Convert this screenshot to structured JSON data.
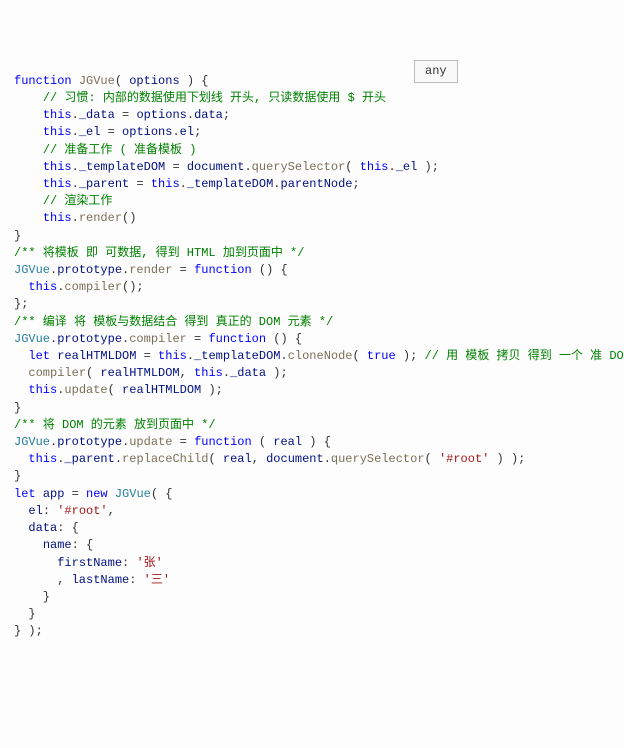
{
  "tooltip": "any",
  "lines": [
    [
      [
        "kw",
        "function "
      ],
      [
        "fn",
        "JGVue"
      ],
      [
        "punc",
        "( "
      ],
      [
        "prop",
        "options"
      ],
      [
        "punc",
        " ) {"
      ]
    ],
    [
      [
        "punc",
        "    "
      ],
      [
        "cmt",
        "// 习惯: 内部的数据使用下划线 开头, 只读数据使用 $ 开头"
      ]
    ],
    [
      [
        "punc",
        "    "
      ],
      [
        "kw",
        "this"
      ],
      [
        "punc",
        "."
      ],
      [
        "prop",
        "_data"
      ],
      [
        "punc",
        " = "
      ],
      [
        "prop",
        "options"
      ],
      [
        "punc",
        "."
      ],
      [
        "prop",
        "data"
      ],
      [
        "punc",
        ";"
      ]
    ],
    [
      [
        "punc",
        "    "
      ],
      [
        "kw",
        "this"
      ],
      [
        "punc",
        "."
      ],
      [
        "prop",
        "_el"
      ],
      [
        "punc",
        " = "
      ],
      [
        "prop",
        "options"
      ],
      [
        "punc",
        "."
      ],
      [
        "prop",
        "el"
      ],
      [
        "punc",
        ";"
      ]
    ],
    [
      [
        "punc",
        "    "
      ],
      [
        "cmt",
        "// 准备工作 ( 准备模板 )"
      ]
    ],
    [
      [
        "punc",
        "    "
      ],
      [
        "kw",
        "this"
      ],
      [
        "punc",
        "."
      ],
      [
        "prop",
        "_templateDOM"
      ],
      [
        "punc",
        " = "
      ],
      [
        "prop",
        "document"
      ],
      [
        "punc",
        "."
      ],
      [
        "fn",
        "querySelector"
      ],
      [
        "punc",
        "( "
      ],
      [
        "kw",
        "this"
      ],
      [
        "punc",
        "."
      ],
      [
        "prop",
        "_el"
      ],
      [
        "punc",
        " );"
      ]
    ],
    [
      [
        "punc",
        "    "
      ],
      [
        "kw",
        "this"
      ],
      [
        "punc",
        "."
      ],
      [
        "prop",
        "_parent"
      ],
      [
        "punc",
        " = "
      ],
      [
        "kw",
        "this"
      ],
      [
        "punc",
        "."
      ],
      [
        "prop",
        "_templateDOM"
      ],
      [
        "punc",
        "."
      ],
      [
        "prop",
        "parentNode"
      ],
      [
        "punc",
        ";"
      ]
    ],
    [
      [
        "punc",
        "    "
      ],
      [
        "cmt",
        "// 渲染工作"
      ]
    ],
    [
      [
        "punc",
        "    "
      ],
      [
        "kw",
        "this"
      ],
      [
        "punc",
        "."
      ],
      [
        "fn",
        "render"
      ],
      [
        "punc",
        "()"
      ]
    ],
    [
      [
        "punc",
        "}"
      ]
    ],
    [
      [
        "cmt",
        "/** 将模板 即 可数据, 得到 HTML 加到页面中 */"
      ]
    ],
    [
      [
        "var",
        "JGVue"
      ],
      [
        "punc",
        "."
      ],
      [
        "prop",
        "prototype"
      ],
      [
        "punc",
        "."
      ],
      [
        "fn",
        "render"
      ],
      [
        "punc",
        " = "
      ],
      [
        "kw",
        "function"
      ],
      [
        "punc",
        " () {"
      ]
    ],
    [
      [
        "punc",
        "  "
      ],
      [
        "kw",
        "this"
      ],
      [
        "punc",
        "."
      ],
      [
        "fn",
        "compiler"
      ],
      [
        "punc",
        "();"
      ]
    ],
    [
      [
        "punc",
        "};"
      ]
    ],
    [
      [
        "cmt",
        "/** 编译 将 模板与数据结合 得到 真正的 DOM 元素 */"
      ]
    ],
    [
      [
        "var",
        "JGVue"
      ],
      [
        "punc",
        "."
      ],
      [
        "prop",
        "prototype"
      ],
      [
        "punc",
        "."
      ],
      [
        "fn",
        "compiler"
      ],
      [
        "punc",
        " = "
      ],
      [
        "kw",
        "function"
      ],
      [
        "punc",
        " () {"
      ]
    ],
    [
      [
        "punc",
        "  "
      ],
      [
        "kw",
        "let"
      ],
      [
        "punc",
        " "
      ],
      [
        "prop",
        "realHTMLDOM"
      ],
      [
        "punc",
        " = "
      ],
      [
        "kw",
        "this"
      ],
      [
        "punc",
        "."
      ],
      [
        "prop",
        "_templateDOM"
      ],
      [
        "punc",
        "."
      ],
      [
        "fn",
        "cloneNode"
      ],
      [
        "punc",
        "( "
      ],
      [
        "kw",
        "true"
      ],
      [
        "punc",
        " ); "
      ],
      [
        "cmt",
        "// 用 模板 拷贝 得到 一个 准 DOM"
      ]
    ],
    [
      [
        "punc",
        "  "
      ],
      [
        "fn",
        "compiler"
      ],
      [
        "punc",
        "( "
      ],
      [
        "prop",
        "realHTMLDOM"
      ],
      [
        "punc",
        ", "
      ],
      [
        "kw",
        "this"
      ],
      [
        "punc",
        "."
      ],
      [
        "prop",
        "_data"
      ],
      [
        "punc",
        " );"
      ]
    ],
    [
      [
        "punc",
        "  "
      ],
      [
        "kw",
        "this"
      ],
      [
        "punc",
        "."
      ],
      [
        "fn",
        "update"
      ],
      [
        "punc",
        "( "
      ],
      [
        "prop",
        "realHTMLDOM"
      ],
      [
        "punc",
        " );"
      ]
    ],
    [
      [
        "punc",
        "}"
      ]
    ],
    [
      [
        "cmt",
        "/** 将 DOM 的元素 放到页面中 */"
      ]
    ],
    [
      [
        "var",
        "JGVue"
      ],
      [
        "punc",
        "."
      ],
      [
        "prop",
        "prototype"
      ],
      [
        "punc",
        "."
      ],
      [
        "fn",
        "update"
      ],
      [
        "punc",
        " = "
      ],
      [
        "kw",
        "function"
      ],
      [
        "punc",
        " ( "
      ],
      [
        "prop",
        "real"
      ],
      [
        "punc",
        " ) {"
      ]
    ],
    [
      [
        "punc",
        "  "
      ],
      [
        "kw",
        "this"
      ],
      [
        "punc",
        "."
      ],
      [
        "prop",
        "_parent"
      ],
      [
        "punc",
        "."
      ],
      [
        "fn",
        "replaceChild"
      ],
      [
        "punc",
        "( "
      ],
      [
        "prop",
        "real"
      ],
      [
        "punc",
        ", "
      ],
      [
        "prop",
        "document"
      ],
      [
        "punc",
        "."
      ],
      [
        "fn",
        "querySelector"
      ],
      [
        "punc",
        "( "
      ],
      [
        "str",
        "'#root'"
      ],
      [
        "punc",
        " ) );"
      ]
    ],
    [
      [
        "punc",
        "}"
      ]
    ],
    [
      [
        "punc",
        ""
      ]
    ],
    [
      [
        "kw",
        "let"
      ],
      [
        "punc",
        " "
      ],
      [
        "prop",
        "app"
      ],
      [
        "punc",
        " = "
      ],
      [
        "kw",
        "new"
      ],
      [
        "punc",
        " "
      ],
      [
        "var",
        "JGVue"
      ],
      [
        "punc",
        "( {"
      ]
    ],
    [
      [
        "punc",
        "  "
      ],
      [
        "prop",
        "el"
      ],
      [
        "punc",
        ": "
      ],
      [
        "str",
        "'#root'"
      ],
      [
        "punc",
        ","
      ]
    ],
    [
      [
        "punc",
        "  "
      ],
      [
        "prop",
        "data"
      ],
      [
        "punc",
        ": {"
      ]
    ],
    [
      [
        "punc",
        "    "
      ],
      [
        "prop",
        "name"
      ],
      [
        "punc",
        ": {"
      ]
    ],
    [
      [
        "punc",
        "      "
      ],
      [
        "prop",
        "firstName"
      ],
      [
        "punc",
        ": "
      ],
      [
        "str",
        "'张'"
      ]
    ],
    [
      [
        "punc",
        "      , "
      ],
      [
        "prop",
        "lastName"
      ],
      [
        "punc",
        ": "
      ],
      [
        "str",
        "'三'"
      ]
    ],
    [
      [
        "punc",
        "    }"
      ]
    ],
    [
      [
        "punc",
        "  }"
      ]
    ],
    [
      [
        "punc",
        "} );"
      ]
    ]
  ]
}
